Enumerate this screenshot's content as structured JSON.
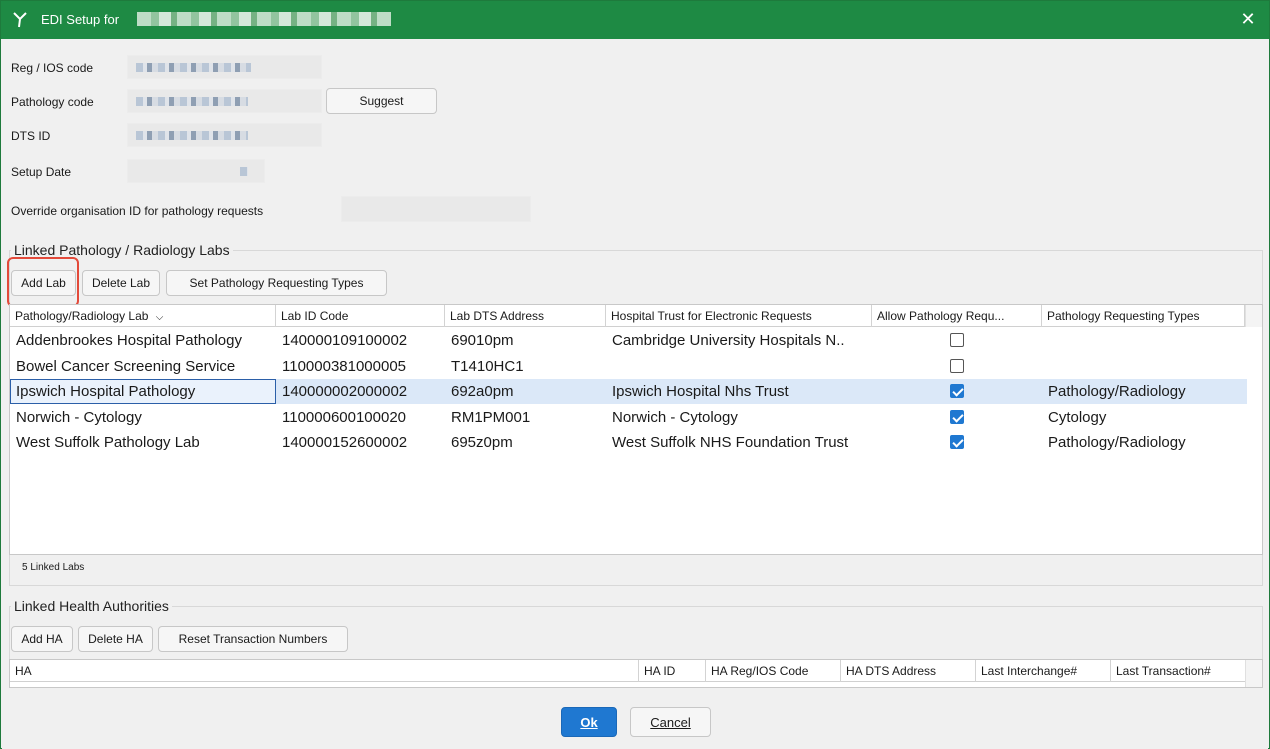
{
  "window": {
    "title": "EDI Setup for"
  },
  "form": {
    "reg_ios_label": "Reg / IOS code",
    "pathology_code_label": "Pathology code",
    "suggest_label": "Suggest",
    "dts_id_label": "DTS ID",
    "setup_date_label": "Setup Date",
    "override_label": "Override organisation ID for pathology requests"
  },
  "labs": {
    "group_title": "Linked Pathology / Radiology Labs",
    "add_label": "Add Lab",
    "delete_label": "Delete Lab",
    "set_types_label": "Set Pathology Requesting Types",
    "columns": [
      "Pathology/Radiology Lab",
      "Lab ID Code",
      "Lab DTS Address",
      "Hospital Trust for Electronic Requests",
      "Allow Pathology Requ...",
      "Pathology Requesting Types"
    ],
    "rows": [
      {
        "lab": "Addenbrookes Hospital Pathology",
        "id": "140000109100002",
        "dts": "69010pm",
        "trust": "Cambridge University Hospitals N..",
        "allow": false,
        "types": ""
      },
      {
        "lab": "Bowel Cancer Screening Service",
        "id": "110000381000005",
        "dts": "T1410HC1",
        "trust": "",
        "allow": false,
        "types": ""
      },
      {
        "lab": "Ipswich Hospital Pathology",
        "id": "140000002000002",
        "dts": "692a0pm",
        "trust": "Ipswich Hospital Nhs Trust",
        "allow": true,
        "types": "Pathology/Radiology",
        "selected": true
      },
      {
        "lab": "Norwich - Cytology",
        "id": "110000600100020",
        "dts": "RM1PM001",
        "trust": "Norwich - Cytology",
        "allow": true,
        "types": "Cytology"
      },
      {
        "lab": "West Suffolk Pathology Lab",
        "id": "140000152600002",
        "dts": "695z0pm",
        "trust": "West Suffolk NHS Foundation Trust",
        "allow": true,
        "types": "Pathology/Radiology"
      }
    ],
    "count_label": "5 Linked Labs"
  },
  "ha": {
    "group_title": "Linked Health Authorities",
    "add_label": "Add HA",
    "delete_label": "Delete HA",
    "reset_label": "Reset Transaction Numbers",
    "columns": [
      "HA",
      "HA ID",
      "HA Reg/IOS Code",
      "HA DTS Address",
      "Last Interchange#",
      "Last Transaction#"
    ]
  },
  "footer": {
    "ok_label": "Ok",
    "cancel_label": "Cancel"
  },
  "colors": {
    "title_bar": "#1e8a44",
    "accent": "#1f78d1",
    "highlight_ring": "#e34a3a",
    "selected_row": "#dbe8f8"
  }
}
